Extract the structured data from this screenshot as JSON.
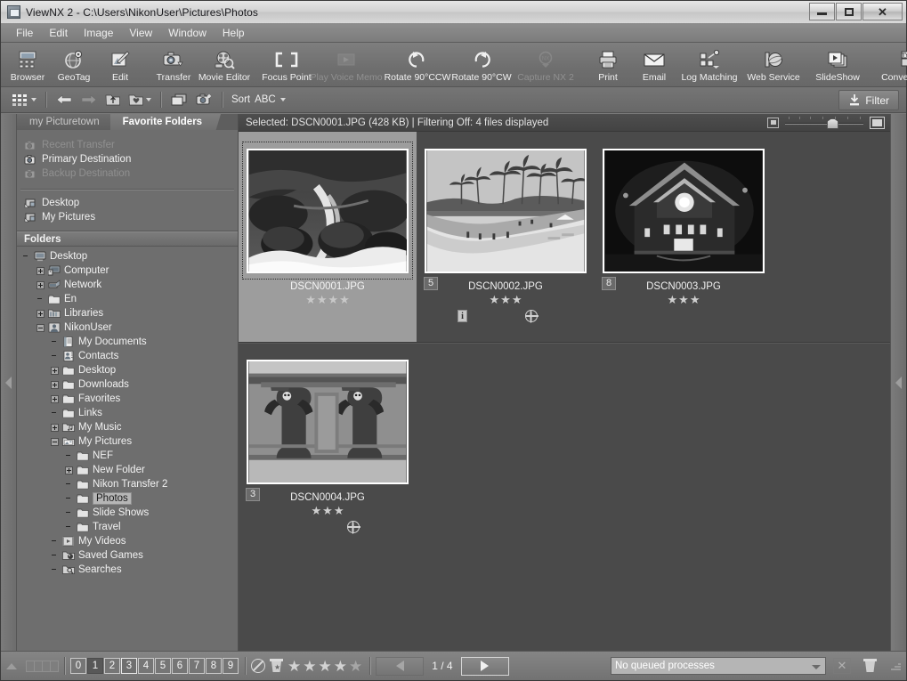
{
  "window": {
    "title": "ViewNX 2 - C:\\Users\\NikonUser\\Pictures\\Photos",
    "minimize_label": "Minimize",
    "maximize_label": "Restore",
    "close_label": "Close"
  },
  "menubar": {
    "items": [
      {
        "label": "File"
      },
      {
        "label": "Edit"
      },
      {
        "label": "Image"
      },
      {
        "label": "View"
      },
      {
        "label": "Window"
      },
      {
        "label": "Help"
      }
    ]
  },
  "toolbar": {
    "buttons": [
      {
        "label": "Browser",
        "icon": "browser-icon",
        "disabled": false
      },
      {
        "label": "GeoTag",
        "icon": "geotag-icon",
        "disabled": false
      },
      {
        "label": "Edit",
        "icon": "edit-icon",
        "disabled": false
      },
      {
        "label": "Transfer",
        "icon": "transfer-icon",
        "disabled": false
      },
      {
        "label": "Movie Editor",
        "icon": "movie-editor-icon",
        "disabled": false
      },
      {
        "label": "Focus Point",
        "icon": "focus-point-icon",
        "disabled": false
      },
      {
        "label": "Play Voice Memo",
        "icon": "play-voice-memo-icon",
        "disabled": true
      },
      {
        "label": "Rotate 90°CCW",
        "icon": "rotate-ccw-icon",
        "disabled": false
      },
      {
        "label": "Rotate 90°CW",
        "icon": "rotate-cw-icon",
        "disabled": false
      },
      {
        "label": "Capture NX 2",
        "icon": "capture-nx2-icon",
        "disabled": true
      },
      {
        "label": "Print",
        "icon": "print-icon",
        "disabled": false
      },
      {
        "label": "Email",
        "icon": "email-icon",
        "disabled": false
      },
      {
        "label": "Log Matching",
        "icon": "log-matching-icon",
        "disabled": false
      },
      {
        "label": "Web Service",
        "icon": "web-service-icon",
        "disabled": false
      },
      {
        "label": "SlideShow",
        "icon": "slideshow-icon",
        "disabled": false
      },
      {
        "label": "Convert Files",
        "icon": "convert-files-icon",
        "disabled": false
      }
    ]
  },
  "toolbar2": {
    "view_mode_label": "Thumbnail Grid",
    "back_label": "Back",
    "forward_label": "Forward",
    "up_label": "Up One Level",
    "favorite_label": "Add to Favorites",
    "compare_label": "Compare",
    "open_with_label": "Open With",
    "sort_label": "Sort",
    "sort_value": "ABC",
    "filter_label": "Filter"
  },
  "sidebar": {
    "tabs": [
      {
        "label": "my Picturetown",
        "active": false
      },
      {
        "label": "Favorite Folders",
        "active": true
      }
    ],
    "favorites_top": [
      {
        "label": "Recent Transfer",
        "icon": "camera-folder-icon",
        "disabled": true
      },
      {
        "label": "Primary Destination",
        "icon": "camera-folder-icon",
        "disabled": false
      },
      {
        "label": "Backup Destination",
        "icon": "camera-folder-icon",
        "disabled": true
      }
    ],
    "favorites_bottom": [
      {
        "label": "Desktop",
        "icon": "shortcut-folder-icon",
        "disabled": false
      },
      {
        "label": "My Pictures",
        "icon": "shortcut-folder-icon",
        "disabled": false
      }
    ],
    "folders_header": "Folders",
    "tree": [
      {
        "label": "Desktop",
        "indent": 0,
        "expander": "none",
        "icon": "desktop-icon",
        "selected": false
      },
      {
        "label": "Computer",
        "indent": 1,
        "expander": "plus",
        "icon": "computer-icon",
        "selected": false
      },
      {
        "label": "Network",
        "indent": 1,
        "expander": "plus",
        "icon": "network-icon",
        "selected": false
      },
      {
        "label": "En",
        "indent": 1,
        "expander": "none",
        "icon": "folder-icon",
        "selected": false
      },
      {
        "label": "Libraries",
        "indent": 1,
        "expander": "plus",
        "icon": "libraries-icon",
        "selected": false
      },
      {
        "label": "NikonUser",
        "indent": 1,
        "expander": "minus",
        "icon": "user-icon",
        "selected": false
      },
      {
        "label": "My Documents",
        "indent": 2,
        "expander": "none",
        "icon": "documents-icon",
        "selected": false
      },
      {
        "label": "Contacts",
        "indent": 2,
        "expander": "none",
        "icon": "contacts-icon",
        "selected": false
      },
      {
        "label": "Desktop",
        "indent": 2,
        "expander": "plus",
        "icon": "folder-icon",
        "selected": false
      },
      {
        "label": "Downloads",
        "indent": 2,
        "expander": "plus",
        "icon": "folder-icon",
        "selected": false
      },
      {
        "label": "Favorites",
        "indent": 2,
        "expander": "plus",
        "icon": "folder-icon",
        "selected": false
      },
      {
        "label": "Links",
        "indent": 2,
        "expander": "none",
        "icon": "folder-icon",
        "selected": false
      },
      {
        "label": "My Music",
        "indent": 2,
        "expander": "plus",
        "icon": "music-icon",
        "selected": false
      },
      {
        "label": "My Pictures",
        "indent": 2,
        "expander": "minus",
        "icon": "pictures-icon",
        "selected": false
      },
      {
        "label": "NEF",
        "indent": 3,
        "expander": "none",
        "icon": "folder-icon",
        "selected": false
      },
      {
        "label": "New Folder",
        "indent": 3,
        "expander": "plus",
        "icon": "folder-icon",
        "selected": false
      },
      {
        "label": "Nikon Transfer 2",
        "indent": 3,
        "expander": "none",
        "icon": "folder-icon",
        "selected": false
      },
      {
        "label": "Photos",
        "indent": 3,
        "expander": "none",
        "icon": "folder-icon",
        "selected": true
      },
      {
        "label": "Slide Shows",
        "indent": 3,
        "expander": "none",
        "icon": "folder-icon",
        "selected": false
      },
      {
        "label": "Travel",
        "indent": 3,
        "expander": "none",
        "icon": "folder-icon",
        "selected": false
      },
      {
        "label": "My Videos",
        "indent": 2,
        "expander": "none",
        "icon": "video-icon",
        "selected": false
      },
      {
        "label": "Saved Games",
        "indent": 2,
        "expander": "none",
        "icon": "games-icon",
        "selected": false
      },
      {
        "label": "Searches",
        "indent": 2,
        "expander": "none",
        "icon": "search-folder-icon",
        "selected": false
      }
    ]
  },
  "content": {
    "status_text": "Selected: DSCN0001.JPG (428 KB) | Filtering Off: 4 files displayed",
    "zoom_small_label": "Small thumbnails",
    "zoom_large_label": "Large thumbnails",
    "zoom_value": 55,
    "thumbnails": [
      {
        "filename": "DSCN0001.JPG",
        "rating": 4,
        "label_number": "",
        "selected": true,
        "has_info_badge": false,
        "has_globe_badge": false,
        "scene": "waterfall-rocks"
      },
      {
        "filename": "DSCN0002.JPG",
        "rating": 3,
        "label_number": "5",
        "selected": false,
        "has_info_badge": true,
        "has_globe_badge": true,
        "scene": "beach-palms"
      },
      {
        "filename": "DSCN0003.JPG",
        "rating": 3,
        "label_number": "8",
        "selected": false,
        "has_info_badge": false,
        "has_globe_badge": false,
        "scene": "night-building"
      },
      {
        "filename": "DSCN0004.JPG",
        "rating": 3,
        "label_number": "3",
        "selected": false,
        "has_info_badge": false,
        "has_globe_badge": true,
        "scene": "temple-statues"
      }
    ]
  },
  "bottombar": {
    "expand_label": "Expand panel",
    "filmstrip_label": "Filmstrip view",
    "label_numbers": [
      {
        "value": "0",
        "state": "normal"
      },
      {
        "value": "1",
        "state": "pressed"
      },
      {
        "value": "2",
        "state": "normal"
      },
      {
        "value": "3",
        "state": "highlighted"
      },
      {
        "value": "4",
        "state": "normal"
      },
      {
        "value": "5",
        "state": "normal"
      },
      {
        "value": "6",
        "state": "normal"
      },
      {
        "value": "7",
        "state": "normal"
      },
      {
        "value": "8",
        "state": "normal"
      },
      {
        "value": "9",
        "state": "normal"
      }
    ],
    "no_rating_label": "No rating",
    "delete_rating_label": "Delete candidate",
    "rating_stars": 5,
    "prev_label": "Previous page",
    "next_label": "Next page",
    "page_indicator": "1 / 4",
    "queue_value": "No queued processes",
    "cancel_label": "Cancel",
    "trash_label": "Delete"
  },
  "colors": {
    "window_bg": "#787878",
    "toolbar_bg": "#6e6e6e",
    "content_bg": "#4a4a4a",
    "selected_cell": "#9d9d9d",
    "text": "#f2f2f2"
  }
}
